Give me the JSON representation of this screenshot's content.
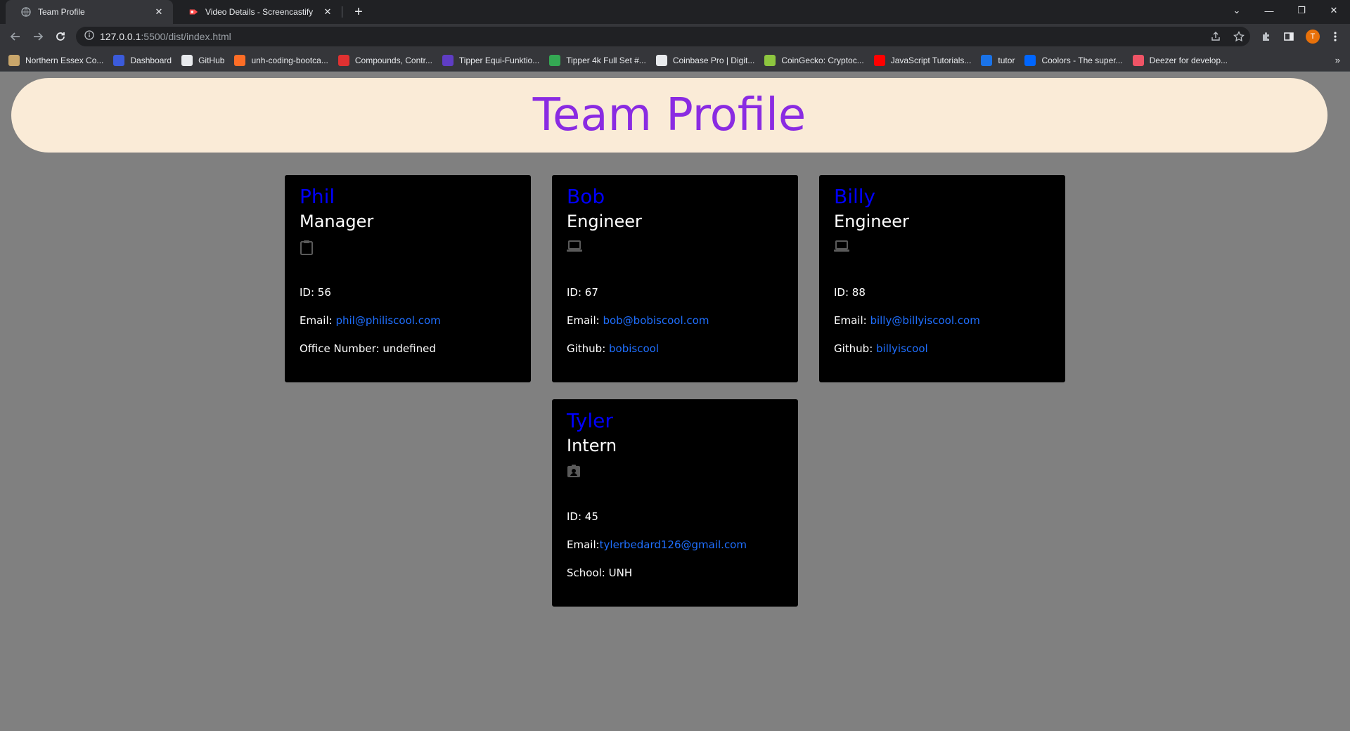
{
  "browser": {
    "tabs": [
      {
        "title": "Team Profile",
        "active": true
      },
      {
        "title": "Video Details - Screencastify",
        "active": false
      }
    ],
    "url_host": "127.0.0.1",
    "url_rest": ":5500/dist/index.html",
    "profile_initial": "T",
    "bookmarks": [
      {
        "label": "Northern Essex Co...",
        "color": "#c9a66b"
      },
      {
        "label": "Dashboard",
        "color": "#3b5bdb"
      },
      {
        "label": "GitHub",
        "color": "#e8eaed"
      },
      {
        "label": "unh-coding-bootca...",
        "color": "#fc6d26"
      },
      {
        "label": "Compounds, Contr...",
        "color": "#e03131"
      },
      {
        "label": "Tipper Equi-Funktio...",
        "color": "#5f3dc4"
      },
      {
        "label": "Tipper 4k Full Set #...",
        "color": "#34a853"
      },
      {
        "label": "Coinbase Pro | Digit...",
        "color": "#e8eaed"
      },
      {
        "label": "CoinGecko: Cryptoc...",
        "color": "#8dc63f"
      },
      {
        "label": "JavaScript Tutorials...",
        "color": "#ff0000"
      },
      {
        "label": "tutor",
        "color": "#1a73e8"
      },
      {
        "label": "Coolors - The super...",
        "color": "#0066ff"
      },
      {
        "label": "Deezer for develop...",
        "color": "#ef5466"
      }
    ]
  },
  "page": {
    "title": "Team Profile",
    "cards": [
      {
        "name": "Phil",
        "role": "Manager",
        "icon": "clipboard-icon",
        "id_label": "ID: 56",
        "email_label": "Email: ",
        "email": "phil@philiscool.com",
        "extra_label": "Office Number: undefined",
        "extra_link": ""
      },
      {
        "name": "Bob",
        "role": "Engineer",
        "icon": "laptop-icon",
        "id_label": "ID: 67",
        "email_label": "Email: ",
        "email": "bob@bobiscool.com",
        "extra_label": "Github: ",
        "extra_link": "bobiscool"
      },
      {
        "name": "Billy",
        "role": "Engineer",
        "icon": "laptop-icon",
        "id_label": "ID: 88",
        "email_label": "Email: ",
        "email": "billy@billyiscool.com",
        "extra_label": "Github: ",
        "extra_link": "billyiscool"
      },
      {
        "name": "Tyler",
        "role": "Intern",
        "icon": "id-badge-icon",
        "id_label": "ID: 45",
        "email_label": "Email:",
        "email": "tylerbedard126@gmail.com",
        "extra_label": "School: UNH",
        "extra_link": ""
      }
    ]
  },
  "colors": {
    "page_bg": "#808080",
    "header_bg": "#faebd7",
    "title_color": "#8a2be2",
    "card_bg": "#000000",
    "name_color": "#0000ff",
    "link_color": "#1f6fff"
  }
}
